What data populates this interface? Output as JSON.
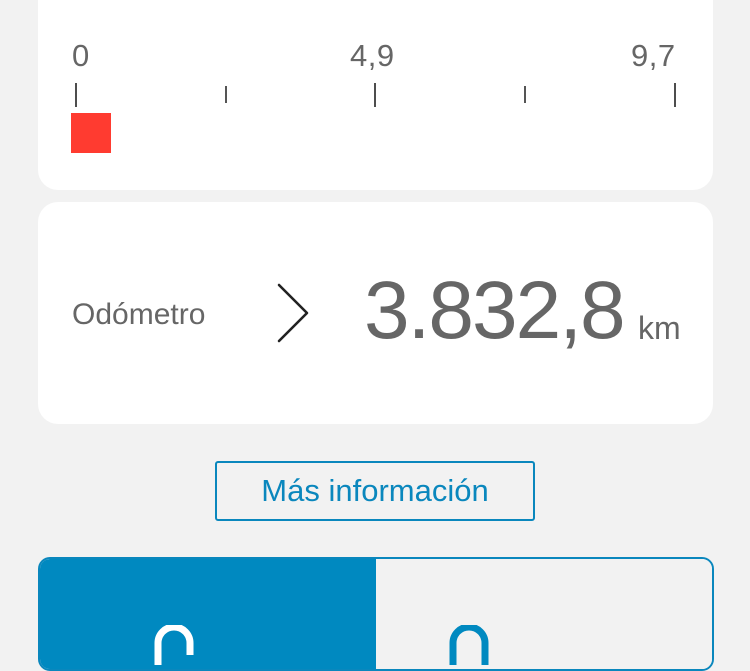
{
  "range_scale": {
    "tick_labels": [
      "0",
      "4,9",
      "9,7"
    ],
    "fill_color": "#ff3b30",
    "level_fraction": 0.0
  },
  "odometer": {
    "label": "Odómetro",
    "value": "3.832,8",
    "unit": "km",
    "icon": "chevron-right-icon"
  },
  "more_info": {
    "label": "Más información"
  },
  "lock_toggle": {
    "options": [
      {
        "icon": "lock-open-icon",
        "selected": true
      },
      {
        "icon": "lock-closed-icon",
        "selected": false
      }
    ],
    "accent_color": "#0089c0"
  }
}
